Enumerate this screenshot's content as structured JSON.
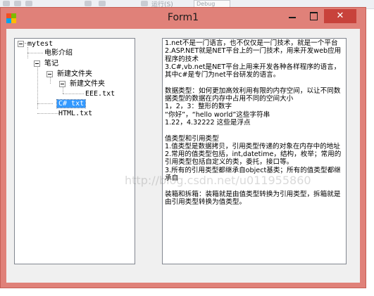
{
  "window": {
    "title": "Form1",
    "close_glyph": "✕",
    "icons": [
      "app-icon",
      "minimize-icon",
      "maximize-icon",
      "close-icon"
    ],
    "app_icon_colors": [
      "#f25022",
      "#7fba00",
      "#00a4ef",
      "#ffb900"
    ]
  },
  "background": {
    "menu_text": "运行(S)",
    "config_combo": "Debug"
  },
  "tree": {
    "root": "mytest",
    "items": {
      "intro": "电影介绍",
      "notes": "笔记",
      "folder1": "新建文件夹",
      "folder2": "新建文件夹",
      "eee": "EEE.txt",
      "csharp": "C# txt",
      "html": "HTML.txt"
    }
  },
  "content": {
    "paragraphs": [
      "1.net不是一门语言，也不仅仅是一门技术，就是一个平台",
      "2.ASP.NET就是NET平台上的一门技术，用来开发web应用程序的技术",
      "3.C#,vb.net是NET平台上用来开发各种各样程序的语言，其中c#是专门为net平台研发的语言。",
      "",
      "数据类型：如何更加高效利用有限的内存空间，以让不同数据类型的数据在内存中占用不同的空间大小",
      "1，2，3：整形的数字",
      "“你好”，“hello world”这些字符串",
      "1.22，4.32222 这些是浮点",
      "",
      "值类型和引用类型",
      "1.值类型是数据拷贝，引用类型传递的对象在内存中的地址",
      "2.常用的值类型包括，int,datetime，结构，枚举；常用的引用类型包括自定义的类，委托，接口等。",
      "3.所有的引用类型都继承自object基类；所有的值类型都继承自",
      "",
      "装箱和拆箱：装箱就是由值类型转换为引用类型，拆箱就是由引用类型转换为值类型。"
    ]
  },
  "watermark": "http://blog.csdn.net/u011955860"
}
